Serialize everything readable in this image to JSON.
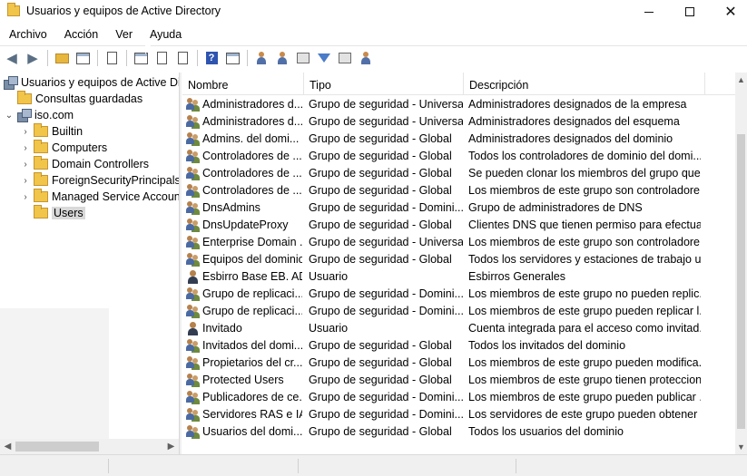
{
  "window": {
    "title": "Usuarios y equipos de Active Directory",
    "controls": {
      "close": "✕"
    }
  },
  "menu": [
    "Archivo",
    "Acción",
    "Ver",
    "Ayuda"
  ],
  "toolbar": {
    "icons": [
      "back-icon",
      "forward-icon",
      "up-folder-icon",
      "show-hide-tree-icon",
      "clipboard-icon",
      "details-view-icon",
      "refresh-icon",
      "export-list-icon",
      "help-icon",
      "properties-icon",
      "new-user-icon",
      "new-group-icon",
      "new-ou-icon",
      "filter-icon",
      "find-icon",
      "add-to-group-icon"
    ],
    "help_glyph": "?"
  },
  "tree": {
    "root": "Usuarios y equipos de Active Directory",
    "saved_queries": "Consultas guardadas",
    "domain": "iso.com",
    "children": [
      "Builtin",
      "Computers",
      "Domain Controllers",
      "ForeignSecurityPrincipals",
      "Managed Service Accounts",
      "Users"
    ],
    "selected": "Users"
  },
  "list": {
    "columns": [
      "Nombre",
      "Tipo",
      "Descripción"
    ],
    "rows": [
      {
        "icon": "group",
        "name": "Administradores d...",
        "type": "Grupo de seguridad - Universal",
        "desc": "Administradores designados de la empresa"
      },
      {
        "icon": "group",
        "name": "Administradores d...",
        "type": "Grupo de seguridad - Universal",
        "desc": "Administradores designados del esquema"
      },
      {
        "icon": "group",
        "name": "Admins. del domi...",
        "type": "Grupo de seguridad - Global",
        "desc": "Administradores designados del dominio"
      },
      {
        "icon": "group",
        "name": "Controladores de ...",
        "type": "Grupo de seguridad - Global",
        "desc": "Todos los controladores de dominio del domi..."
      },
      {
        "icon": "group",
        "name": "Controladores de ...",
        "type": "Grupo de seguridad - Global",
        "desc": "Se pueden clonar los miembros del grupo que ..."
      },
      {
        "icon": "group",
        "name": "Controladores de ...",
        "type": "Grupo de seguridad - Global",
        "desc": "Los miembros de este grupo son controladore..."
      },
      {
        "icon": "group",
        "name": "DnsAdmins",
        "type": "Grupo de seguridad - Domini...",
        "desc": "Grupo de administradores de DNS"
      },
      {
        "icon": "group",
        "name": "DnsUpdateProxy",
        "type": "Grupo de seguridad - Global",
        "desc": "Clientes DNS que tienen permiso para efectuar..."
      },
      {
        "icon": "group",
        "name": "Enterprise Domain ...",
        "type": "Grupo de seguridad - Universal",
        "desc": "Los miembros de este grupo son controladore..."
      },
      {
        "icon": "group",
        "name": "Equipos del dominio",
        "type": "Grupo de seguridad - Global",
        "desc": "Todos los servidores y estaciones de trabajo un..."
      },
      {
        "icon": "user",
        "name": "Esbirro Base EB. AD",
        "type": "Usuario",
        "desc": "Esbirros Generales"
      },
      {
        "icon": "group",
        "name": "Grupo de replicaci...",
        "type": "Grupo de seguridad - Domini...",
        "desc": "Los miembros de este grupo no pueden replic..."
      },
      {
        "icon": "group",
        "name": "Grupo de replicaci...",
        "type": "Grupo de seguridad - Domini...",
        "desc": "Los miembros de este grupo pueden replicar l..."
      },
      {
        "icon": "user",
        "name": "Invitado",
        "type": "Usuario",
        "desc": "Cuenta integrada para el acceso como invitad..."
      },
      {
        "icon": "group",
        "name": "Invitados del domi...",
        "type": "Grupo de seguridad - Global",
        "desc": "Todos los invitados del dominio"
      },
      {
        "icon": "group",
        "name": "Propietarios del cr...",
        "type": "Grupo de seguridad - Global",
        "desc": "Los miembros de este grupo pueden modifica..."
      },
      {
        "icon": "group",
        "name": "Protected Users",
        "type": "Grupo de seguridad - Global",
        "desc": "Los miembros de este grupo tienen proteccion..."
      },
      {
        "icon": "group",
        "name": "Publicadores de ce...",
        "type": "Grupo de seguridad - Domini...",
        "desc": "Los miembros de este grupo pueden publicar ..."
      },
      {
        "icon": "group",
        "name": "Servidores RAS e IAS",
        "type": "Grupo de seguridad - Domini...",
        "desc": "Los servidores de este grupo pueden obtener p..."
      },
      {
        "icon": "group",
        "name": "Usuarios del domi...",
        "type": "Grupo de seguridad - Global",
        "desc": "Todos los usuarios del dominio"
      }
    ]
  },
  "colors": {
    "folder": "#f0c54a",
    "selection": "#d9d9d9",
    "scroll_thumb": "#cdcdcd"
  }
}
